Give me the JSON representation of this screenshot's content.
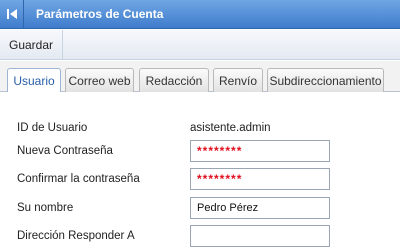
{
  "header": {
    "title": "Parámetros de Cuenta",
    "back_icon": "back-to-start-icon"
  },
  "toolbar": {
    "save_label": "Guardar"
  },
  "tabs": [
    {
      "label": "Usuario",
      "active": true
    },
    {
      "label": "Correo web",
      "active": false
    },
    {
      "label": "Redacción",
      "active": false
    },
    {
      "label": "Renvío",
      "active": false
    },
    {
      "label": "Subdireccionamiento",
      "active": false
    }
  ],
  "form": {
    "user_id_label": "ID de Usuario",
    "user_id_value": "asistente.admin",
    "new_password_label": "Nueva Contraseña",
    "new_password_value": "********",
    "confirm_password_label": "Confirmar la contraseña",
    "confirm_password_value": "********",
    "name_label": "Su nombre",
    "name_value": "Pedro Pérez",
    "reply_to_label": "Dirección Responder A",
    "reply_to_value": ""
  },
  "colors": {
    "header_bg": "#3f7ccc",
    "password_text": "#e0101e"
  }
}
